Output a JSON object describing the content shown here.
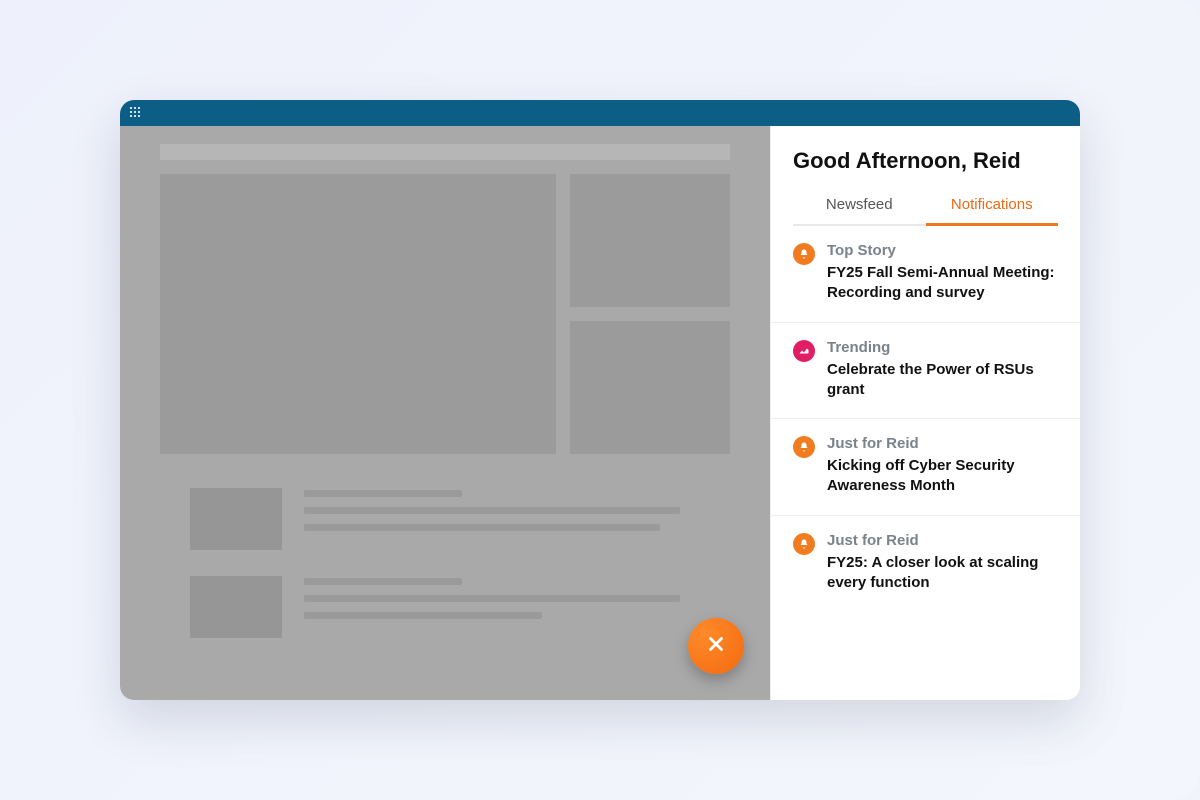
{
  "panel": {
    "greeting": "Good Afternoon, Reid",
    "tabs": {
      "newsfeed": "Newsfeed",
      "notifications": "Notifications",
      "active": "notifications"
    },
    "items": [
      {
        "icon": "bell",
        "iconColor": "orange",
        "category": "Top Story",
        "title": "FY25 Fall Semi-Annual Meeting: Recording and survey"
      },
      {
        "icon": "trend",
        "iconColor": "pink",
        "category": "Trending",
        "title": "Celebrate the Power of RSUs grant"
      },
      {
        "icon": "bell",
        "iconColor": "orange",
        "category": "Just for Reid",
        "title": "Kicking off Cyber Security Awareness Month"
      },
      {
        "icon": "bell",
        "iconColor": "orange",
        "category": "Just for Reid",
        "title": "FY25: A closer look at scaling every function"
      }
    ]
  },
  "colors": {
    "accentOrange": "#f07c1f",
    "accentPink": "#e11e63",
    "titlebar": "#0c5e87"
  }
}
